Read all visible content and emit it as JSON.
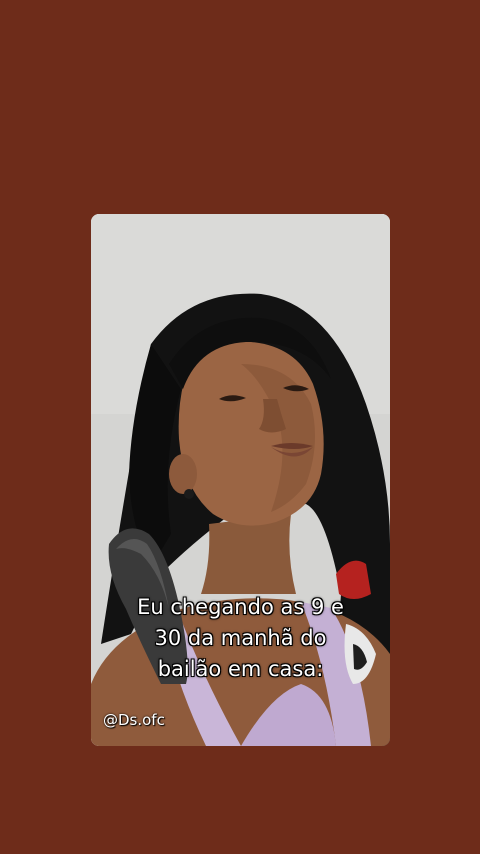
{
  "page": {
    "background_color": "#6e2c1a"
  },
  "story": {
    "caption_lines": [
      "Eu chegando as 9 e",
      "30 da manhã do",
      "bailão em casa:"
    ],
    "watermark": "@Ds.ofc"
  }
}
